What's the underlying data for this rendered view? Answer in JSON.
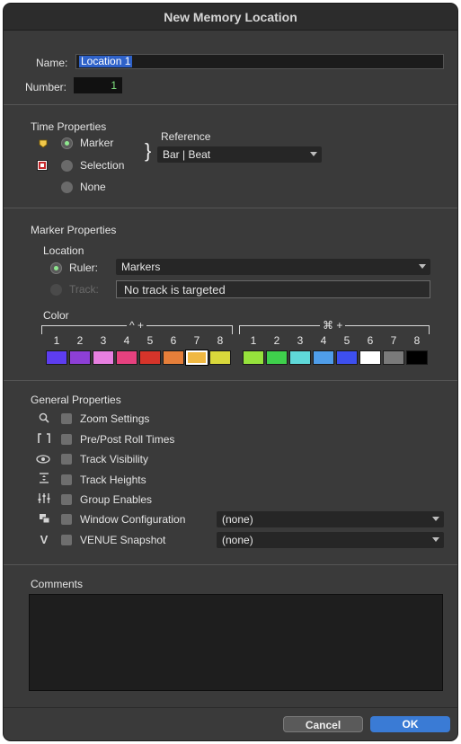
{
  "window": {
    "title": "New Memory Location"
  },
  "name_field": {
    "label": "Name:",
    "value": "Location 1"
  },
  "number_field": {
    "label": "Number:",
    "value": "1"
  },
  "time_properties": {
    "heading": "Time Properties",
    "options": [
      {
        "label": "Marker",
        "selected": true
      },
      {
        "label": "Selection",
        "selected": false
      },
      {
        "label": "None",
        "selected": false
      }
    ],
    "reference": {
      "label": "Reference",
      "value": "Bar | Beat"
    }
  },
  "marker_properties": {
    "heading": "Marker Properties",
    "location_label": "Location",
    "ruler": {
      "label": "Ruler:",
      "value": "Markers"
    },
    "track": {
      "label": "Track:",
      "value": "No track is targeted"
    },
    "color": {
      "label": "Color",
      "group1_header": "^ +",
      "group2_header": "⌘ +",
      "numbers": [
        "1",
        "2",
        "3",
        "4",
        "5",
        "6",
        "7",
        "8"
      ],
      "group1_colors": [
        "#5d3df0",
        "#8d3fd6",
        "#e77fe0",
        "#e6417f",
        "#d6342a",
        "#e67f3a",
        "#f0b843",
        "#d9d83b"
      ],
      "group2_colors": [
        "#96e23c",
        "#3fd04c",
        "#5fd9d9",
        "#4f9de9",
        "#3d4fee",
        "#ffffff",
        "#7a7a7a",
        "#000000"
      ],
      "selected_group": 1,
      "selected_index": 6
    }
  },
  "general_properties": {
    "heading": "General Properties",
    "items": [
      {
        "label": "Zoom Settings",
        "icon": "magnifier-icon"
      },
      {
        "label": "Pre/Post Roll Times",
        "icon": "preroll-icon"
      },
      {
        "label": "Track Visibility",
        "icon": "eye-icon"
      },
      {
        "label": "Track Heights",
        "icon": "track-heights-icon"
      },
      {
        "label": "Group Enables",
        "icon": "group-enables-icon"
      },
      {
        "label": "Window Configuration",
        "icon": "window-config-icon",
        "dropdown": "(none)"
      },
      {
        "label": "VENUE Snapshot",
        "icon": "venue-icon",
        "dropdown": "(none)"
      }
    ]
  },
  "comments": {
    "heading": "Comments",
    "value": ""
  },
  "buttons": {
    "cancel": "Cancel",
    "ok": "OK"
  }
}
